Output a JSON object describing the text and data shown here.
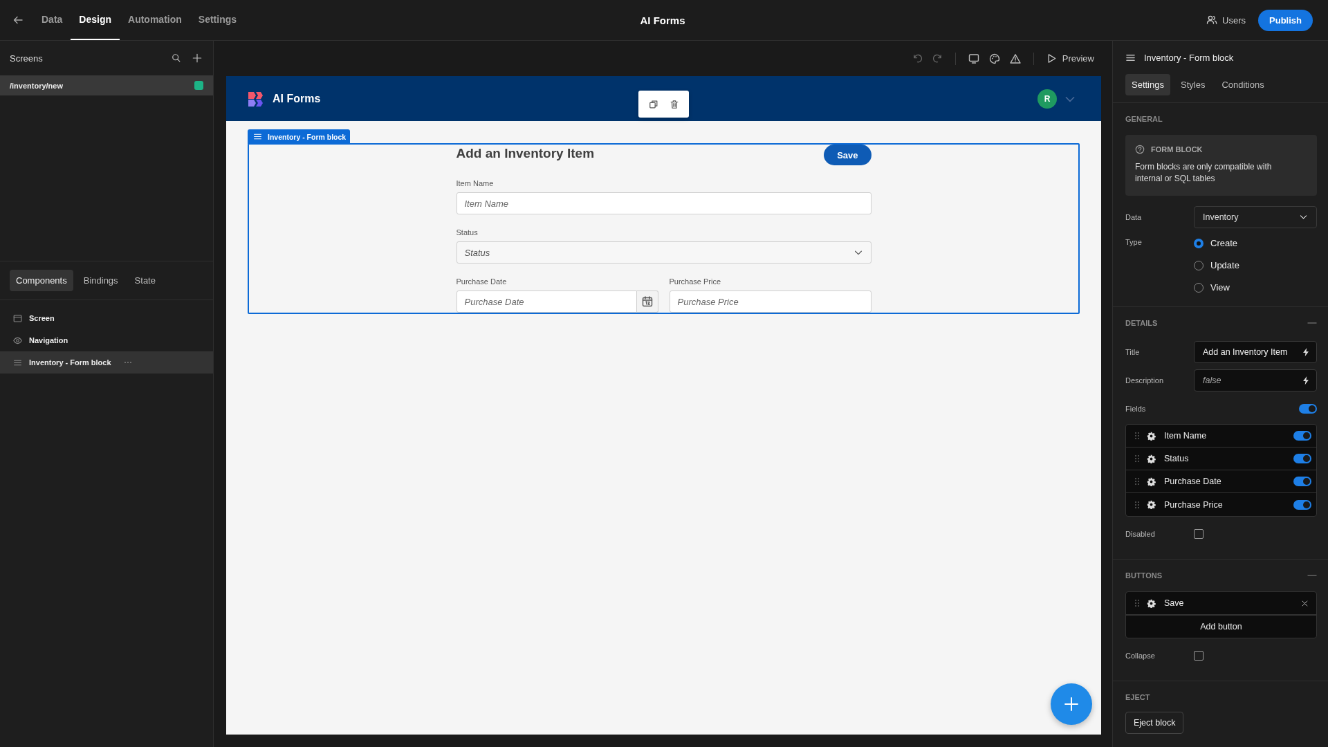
{
  "top_bar": {
    "tabs": [
      {
        "label": "Data",
        "selected": false
      },
      {
        "label": "Design",
        "selected": true
      },
      {
        "label": "Automation",
        "selected": false
      },
      {
        "label": "Settings",
        "selected": false
      }
    ],
    "title": "AI Forms",
    "users_button": "Users",
    "publish_button": "Publish"
  },
  "screens_panel": {
    "title": "Screens",
    "screens": [
      {
        "path": "/inventory/new",
        "selected": true,
        "color": "#1db386"
      }
    ]
  },
  "components_panel": {
    "tabs": [
      {
        "label": "Components",
        "selected": true
      },
      {
        "label": "Bindings",
        "selected": false
      },
      {
        "label": "State",
        "selected": false
      }
    ],
    "tree": [
      {
        "label": "Screen",
        "kind": "screen",
        "selected": false
      },
      {
        "label": "Navigation",
        "kind": "navigation",
        "selected": false
      },
      {
        "label": "Inventory - Form block",
        "kind": "form",
        "selected": true
      }
    ]
  },
  "canvas_toolbar": {
    "preview_button": "Preview"
  },
  "app_preview": {
    "app_title": "AI Forms",
    "avatar": "R",
    "block_label": "Inventory - Form block",
    "form": {
      "title": "Add an Inventory Item",
      "save_button": "Save",
      "fields": [
        {
          "label": "Item Name",
          "placeholder": "Item Name",
          "kind": "text"
        },
        {
          "label": "Status",
          "placeholder": "Status",
          "kind": "select"
        },
        {
          "label": "Purchase Date",
          "placeholder": "Purchase Date",
          "kind": "date"
        },
        {
          "label": "Purchase Price",
          "placeholder": "Purchase Price",
          "kind": "number"
        }
      ]
    }
  },
  "inspector": {
    "title": "Inventory - Form block",
    "tabs": [
      {
        "label": "Settings",
        "selected": true
      },
      {
        "label": "Styles",
        "selected": false
      },
      {
        "label": "Conditions",
        "selected": false
      }
    ],
    "general": {
      "heading": "GENERAL",
      "info_title": "FORM BLOCK",
      "info_text": "Form blocks are only compatible with internal or SQL tables",
      "data_label": "Data",
      "data_value": "Inventory",
      "type_label": "Type",
      "type_options": [
        {
          "label": "Create",
          "selected": true
        },
        {
          "label": "Update",
          "selected": false
        },
        {
          "label": "View",
          "selected": false
        }
      ]
    },
    "details": {
      "heading": "DETAILS",
      "title_label": "Title",
      "title_value": "Add an Inventory Item",
      "description_label": "Description",
      "description_placeholder": "false",
      "fields_label": "Fields",
      "fields_on": true,
      "fields": [
        {
          "label": "Item Name",
          "on": true
        },
        {
          "label": "Status",
          "on": true
        },
        {
          "label": "Purchase Date",
          "on": true
        },
        {
          "label": "Purchase Price",
          "on": true
        }
      ],
      "disabled_label": "Disabled",
      "disabled": false
    },
    "buttons": {
      "heading": "BUTTONS",
      "items": [
        "Save"
      ],
      "add_button": "Add button",
      "collapse_label": "Collapse",
      "collapse": false
    },
    "eject": {
      "heading": "EJECT",
      "button": "Eject block"
    }
  }
}
